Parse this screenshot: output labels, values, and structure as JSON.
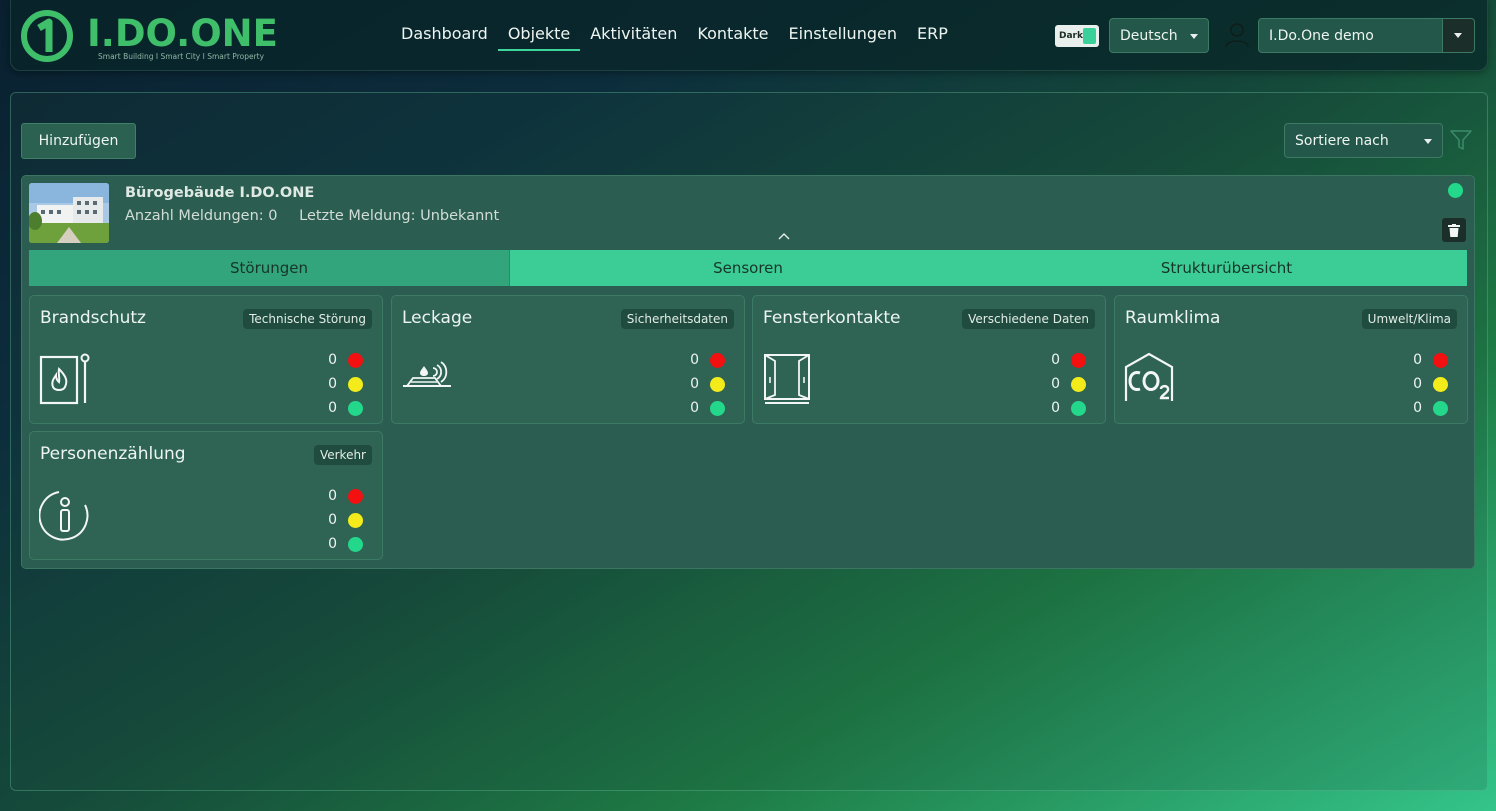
{
  "header": {
    "logo_text": "I.DO.ONE",
    "logo_tagline": "Smart Building I Smart City I Smart Property",
    "nav": [
      {
        "label": "Dashboard",
        "active": false
      },
      {
        "label": "Objekte",
        "active": true
      },
      {
        "label": "Aktivitäten",
        "active": false
      },
      {
        "label": "Kontakte",
        "active": false
      },
      {
        "label": "Einstellungen",
        "active": false
      },
      {
        "label": "ERP",
        "active": false
      }
    ],
    "theme_toggle_label": "Dark",
    "language": "Deutsch",
    "tenant": "I.Do.One demo"
  },
  "toolbar": {
    "add_label": "Hinzufügen",
    "sort_label": "Sortiere nach"
  },
  "object": {
    "title": "Bürogebäude I.DO.ONE",
    "meldungen": "Anzahl Meldungen: 0",
    "letzte": "Letzte Meldung: Unbekannt",
    "tabs": [
      {
        "label": "Störungen",
        "active": true
      },
      {
        "label": "Sensoren",
        "active": false
      },
      {
        "label": "Strukturübersicht",
        "active": false
      }
    ],
    "cards": [
      {
        "title": "Brandschutz",
        "badge": "Technische Störung",
        "icon": "fire-alarm-icon",
        "red": "0",
        "yellow": "0",
        "green": "0"
      },
      {
        "title": "Leckage",
        "badge": "Sicherheitsdaten",
        "icon": "leak-sensor-icon",
        "red": "0",
        "yellow": "0",
        "green": "0"
      },
      {
        "title": "Fensterkontakte",
        "badge": "Verschiedene Daten",
        "icon": "window-icon",
        "red": "0",
        "yellow": "0",
        "green": "0"
      },
      {
        "title": "Raumklima",
        "badge": "Umwelt/Klima",
        "icon": "co2-house-icon",
        "red": "0",
        "yellow": "0",
        "green": "0"
      },
      {
        "title": "Personenzählung",
        "badge": "Verkehr",
        "icon": "info-icon",
        "red": "0",
        "yellow": "0",
        "green": "0"
      }
    ]
  },
  "colors": {
    "accent": "#3ccd96",
    "red": "#f21010",
    "yellow": "#f3ec1a",
    "green": "#23d88a"
  }
}
